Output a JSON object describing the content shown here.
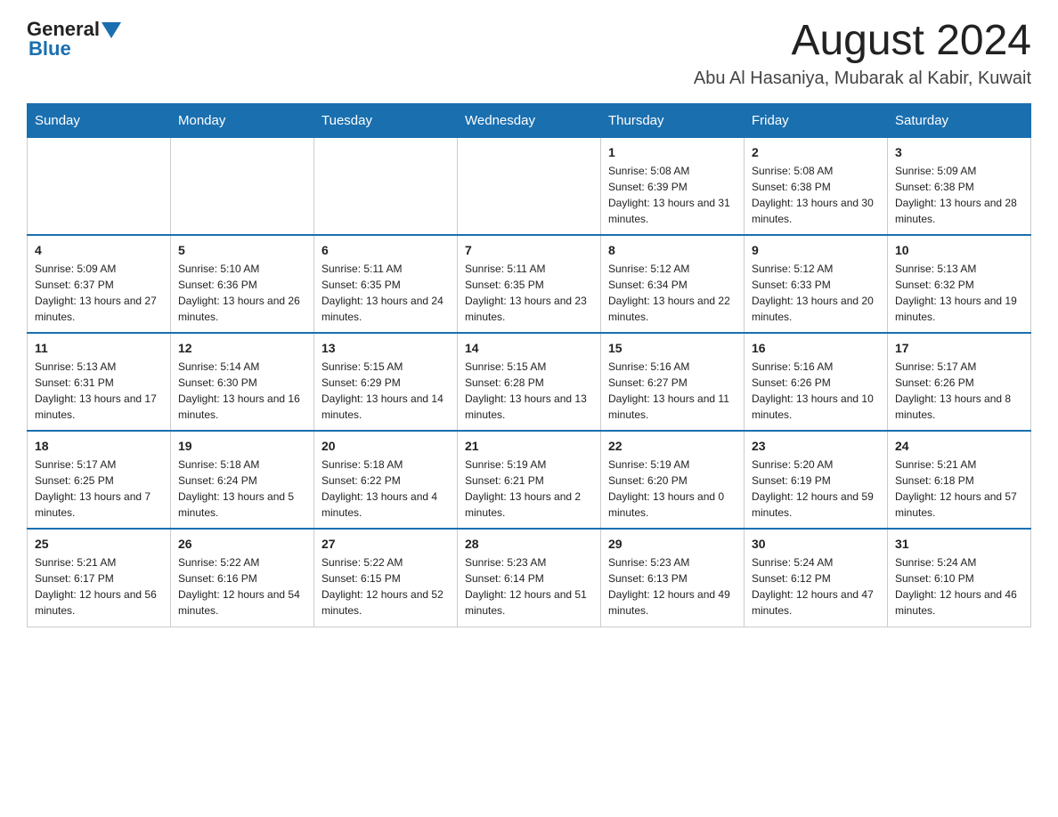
{
  "logo": {
    "general": "General",
    "blue": "Blue"
  },
  "title": "August 2024",
  "subtitle": "Abu Al Hasaniya, Mubarak al Kabir, Kuwait",
  "weekdays": [
    "Sunday",
    "Monday",
    "Tuesday",
    "Wednesday",
    "Thursday",
    "Friday",
    "Saturday"
  ],
  "weeks": [
    [
      {
        "day": "",
        "info": ""
      },
      {
        "day": "",
        "info": ""
      },
      {
        "day": "",
        "info": ""
      },
      {
        "day": "",
        "info": ""
      },
      {
        "day": "1",
        "info": "Sunrise: 5:08 AM\nSunset: 6:39 PM\nDaylight: 13 hours and 31 minutes."
      },
      {
        "day": "2",
        "info": "Sunrise: 5:08 AM\nSunset: 6:38 PM\nDaylight: 13 hours and 30 minutes."
      },
      {
        "day": "3",
        "info": "Sunrise: 5:09 AM\nSunset: 6:38 PM\nDaylight: 13 hours and 28 minutes."
      }
    ],
    [
      {
        "day": "4",
        "info": "Sunrise: 5:09 AM\nSunset: 6:37 PM\nDaylight: 13 hours and 27 minutes."
      },
      {
        "day": "5",
        "info": "Sunrise: 5:10 AM\nSunset: 6:36 PM\nDaylight: 13 hours and 26 minutes."
      },
      {
        "day": "6",
        "info": "Sunrise: 5:11 AM\nSunset: 6:35 PM\nDaylight: 13 hours and 24 minutes."
      },
      {
        "day": "7",
        "info": "Sunrise: 5:11 AM\nSunset: 6:35 PM\nDaylight: 13 hours and 23 minutes."
      },
      {
        "day": "8",
        "info": "Sunrise: 5:12 AM\nSunset: 6:34 PM\nDaylight: 13 hours and 22 minutes."
      },
      {
        "day": "9",
        "info": "Sunrise: 5:12 AM\nSunset: 6:33 PM\nDaylight: 13 hours and 20 minutes."
      },
      {
        "day": "10",
        "info": "Sunrise: 5:13 AM\nSunset: 6:32 PM\nDaylight: 13 hours and 19 minutes."
      }
    ],
    [
      {
        "day": "11",
        "info": "Sunrise: 5:13 AM\nSunset: 6:31 PM\nDaylight: 13 hours and 17 minutes."
      },
      {
        "day": "12",
        "info": "Sunrise: 5:14 AM\nSunset: 6:30 PM\nDaylight: 13 hours and 16 minutes."
      },
      {
        "day": "13",
        "info": "Sunrise: 5:15 AM\nSunset: 6:29 PM\nDaylight: 13 hours and 14 minutes."
      },
      {
        "day": "14",
        "info": "Sunrise: 5:15 AM\nSunset: 6:28 PM\nDaylight: 13 hours and 13 minutes."
      },
      {
        "day": "15",
        "info": "Sunrise: 5:16 AM\nSunset: 6:27 PM\nDaylight: 13 hours and 11 minutes."
      },
      {
        "day": "16",
        "info": "Sunrise: 5:16 AM\nSunset: 6:26 PM\nDaylight: 13 hours and 10 minutes."
      },
      {
        "day": "17",
        "info": "Sunrise: 5:17 AM\nSunset: 6:26 PM\nDaylight: 13 hours and 8 minutes."
      }
    ],
    [
      {
        "day": "18",
        "info": "Sunrise: 5:17 AM\nSunset: 6:25 PM\nDaylight: 13 hours and 7 minutes."
      },
      {
        "day": "19",
        "info": "Sunrise: 5:18 AM\nSunset: 6:24 PM\nDaylight: 13 hours and 5 minutes."
      },
      {
        "day": "20",
        "info": "Sunrise: 5:18 AM\nSunset: 6:22 PM\nDaylight: 13 hours and 4 minutes."
      },
      {
        "day": "21",
        "info": "Sunrise: 5:19 AM\nSunset: 6:21 PM\nDaylight: 13 hours and 2 minutes."
      },
      {
        "day": "22",
        "info": "Sunrise: 5:19 AM\nSunset: 6:20 PM\nDaylight: 13 hours and 0 minutes."
      },
      {
        "day": "23",
        "info": "Sunrise: 5:20 AM\nSunset: 6:19 PM\nDaylight: 12 hours and 59 minutes."
      },
      {
        "day": "24",
        "info": "Sunrise: 5:21 AM\nSunset: 6:18 PM\nDaylight: 12 hours and 57 minutes."
      }
    ],
    [
      {
        "day": "25",
        "info": "Sunrise: 5:21 AM\nSunset: 6:17 PM\nDaylight: 12 hours and 56 minutes."
      },
      {
        "day": "26",
        "info": "Sunrise: 5:22 AM\nSunset: 6:16 PM\nDaylight: 12 hours and 54 minutes."
      },
      {
        "day": "27",
        "info": "Sunrise: 5:22 AM\nSunset: 6:15 PM\nDaylight: 12 hours and 52 minutes."
      },
      {
        "day": "28",
        "info": "Sunrise: 5:23 AM\nSunset: 6:14 PM\nDaylight: 12 hours and 51 minutes."
      },
      {
        "day": "29",
        "info": "Sunrise: 5:23 AM\nSunset: 6:13 PM\nDaylight: 12 hours and 49 minutes."
      },
      {
        "day": "30",
        "info": "Sunrise: 5:24 AM\nSunset: 6:12 PM\nDaylight: 12 hours and 47 minutes."
      },
      {
        "day": "31",
        "info": "Sunrise: 5:24 AM\nSunset: 6:10 PM\nDaylight: 12 hours and 46 minutes."
      }
    ]
  ]
}
